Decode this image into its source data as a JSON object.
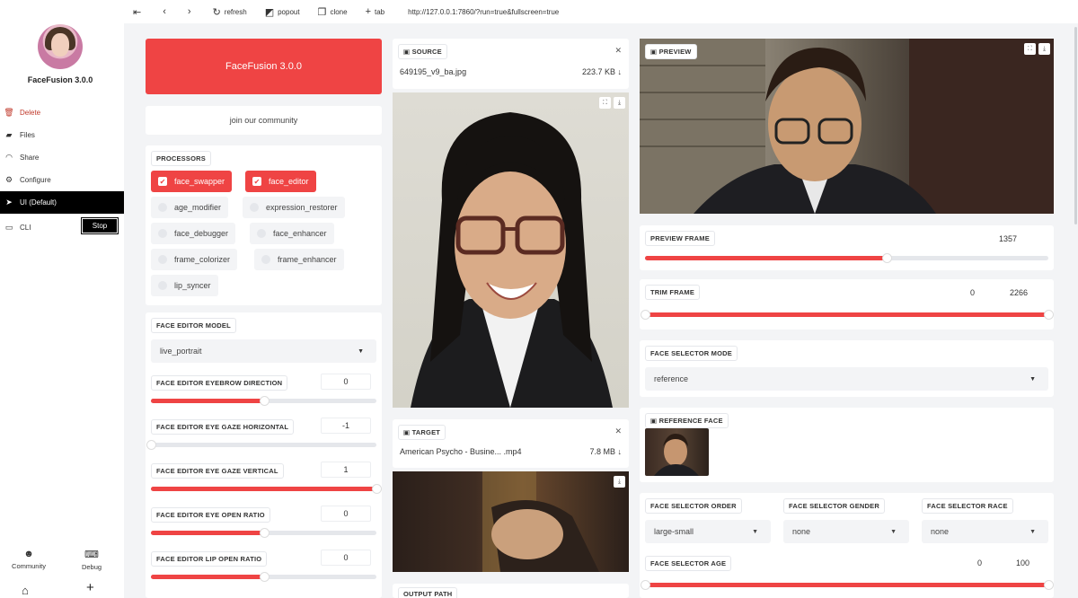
{
  "app": {
    "name": "FaceFusion 3.0.0"
  },
  "sidebar": {
    "items": [
      {
        "icon": "trash-icon",
        "label": "Delete"
      },
      {
        "icon": "folder-icon",
        "label": "Files"
      },
      {
        "icon": "wifi-icon",
        "label": "Share"
      },
      {
        "icon": "gear-icon",
        "label": "Configure"
      },
      {
        "icon": "rocket-icon",
        "label": "UI (Default)"
      },
      {
        "icon": "monitor-icon",
        "label": "CLI"
      }
    ],
    "stop_label": "Stop",
    "community_label": "Community",
    "debug_label": "Debug"
  },
  "toolbar": {
    "refresh": "refresh",
    "popout": "popout",
    "clone": "clone",
    "tab": "tab",
    "url": "http://127.0.0.1:7860/?run=true&fullscreen=true"
  },
  "left": {
    "hero": "FaceFusion 3.0.0",
    "community": "join our community",
    "processors_label": "PROCESSORS",
    "processors": [
      {
        "label": "face_swapper",
        "checked": true
      },
      {
        "label": "face_editor",
        "checked": true
      },
      {
        "label": "age_modifier",
        "checked": false
      },
      {
        "label": "expression_restorer",
        "checked": false
      },
      {
        "label": "face_debugger",
        "checked": false
      },
      {
        "label": "face_enhancer",
        "checked": false
      },
      {
        "label": "frame_colorizer",
        "checked": false
      },
      {
        "label": "frame_enhancer",
        "checked": false
      },
      {
        "label": "lip_syncer",
        "checked": false
      }
    ],
    "face_editor_model_label": "FACE EDITOR MODEL",
    "face_editor_model": "live_portrait",
    "sliders": [
      {
        "label": "FACE EDITOR EYEBROW DIRECTION",
        "value": "0",
        "fraction": 0.5
      },
      {
        "label": "FACE EDITOR EYE GAZE HORIZONTAL",
        "value": "-1",
        "fraction": 0.0
      },
      {
        "label": "FACE EDITOR EYE GAZE VERTICAL",
        "value": "1",
        "fraction": 1.0
      },
      {
        "label": "FACE EDITOR EYE OPEN RATIO",
        "value": "0",
        "fraction": 0.5
      },
      {
        "label": "FACE EDITOR LIP OPEN RATIO",
        "value": "0",
        "fraction": 0.5
      }
    ]
  },
  "middle": {
    "source_label": "SOURCE",
    "source_file": "649195_v9_ba.jpg",
    "source_size": "223.7 KB ↓",
    "target_label": "TARGET",
    "target_file": "American Psycho - Busine... .mp4",
    "target_size": "7.8 MB ↓",
    "output_label": "OUTPUT PATH"
  },
  "right": {
    "preview_label": "PREVIEW",
    "preview_frame_label": "PREVIEW FRAME",
    "preview_frame_value": "1357",
    "preview_frame_fraction": 0.6,
    "trim_frame_label": "TRIM FRAME",
    "trim_start": "0",
    "trim_end": "2266",
    "face_selector_mode_label": "FACE SELECTOR MODE",
    "face_selector_mode": "reference",
    "reference_face_label": "REFERENCE FACE",
    "face_selector_order_label": "FACE SELECTOR ORDER",
    "face_selector_order": "large-small",
    "face_selector_gender_label": "FACE SELECTOR GENDER",
    "face_selector_gender": "none",
    "face_selector_race_label": "FACE SELECTOR RACE",
    "face_selector_race": "none",
    "face_selector_age_label": "FACE SELECTOR AGE",
    "age_start": "0",
    "age_end": "100"
  }
}
